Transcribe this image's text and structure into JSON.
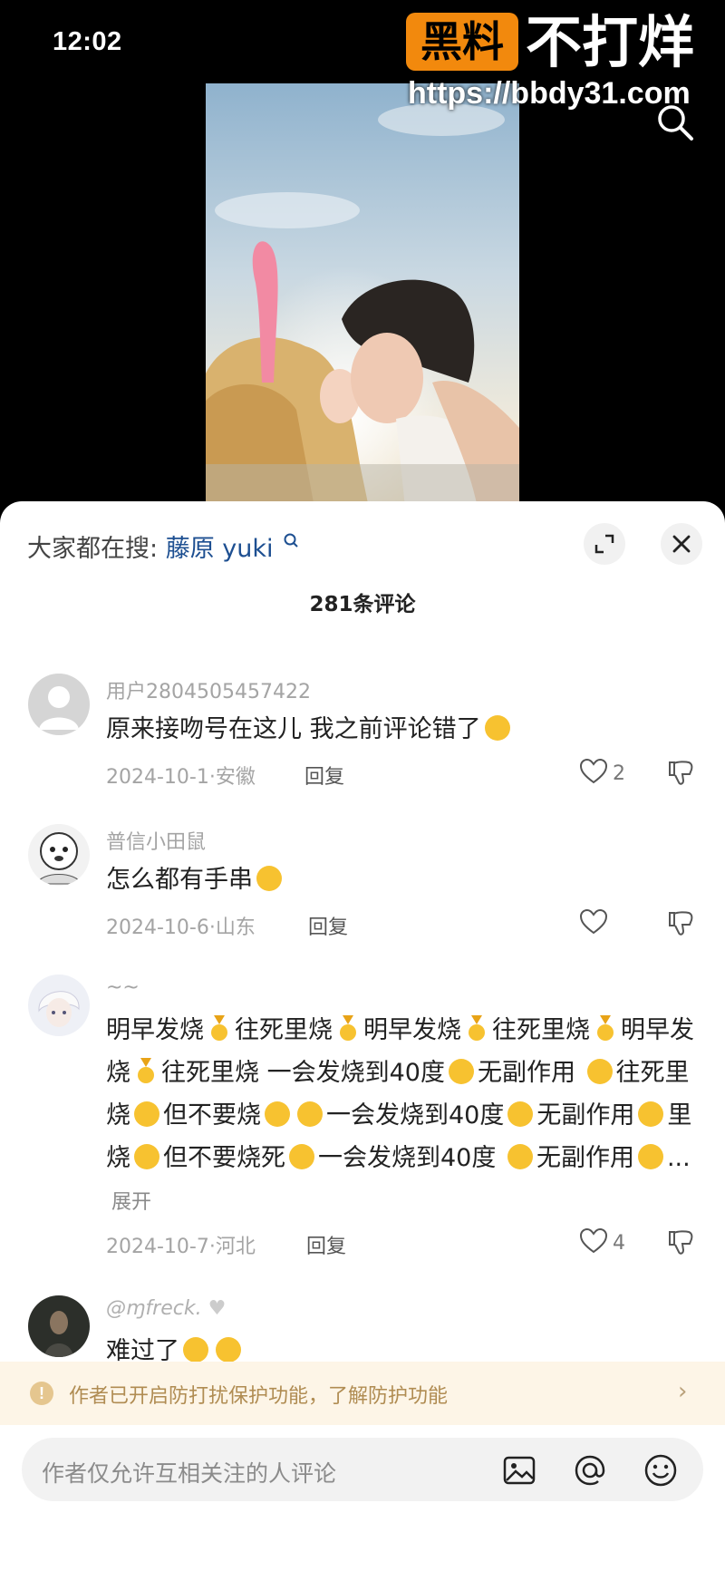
{
  "status_bar": {
    "time": "12:02"
  },
  "watermark": {
    "badge": "黑料",
    "text": "不打烊",
    "url": "https://bbdy31.com"
  },
  "sheet": {
    "hot_search_prefix": "大家都在搜:",
    "hot_search_keyword": "藤原 yuki",
    "comment_count": "281条评论"
  },
  "comments": [
    {
      "username": "用户2804505457422",
      "text": "原来接吻号在这儿 我之前评论错了",
      "date_location": "2024-10-1·安徽",
      "reply_label": "回复",
      "likes": "2"
    },
    {
      "username": "普信小田鼠",
      "text": "怎么都有手串",
      "date_location": "2024-10-6·山东",
      "reply_label": "回复",
      "likes": ""
    },
    {
      "username": "~~",
      "text_parts": [
        "明早发烧",
        "往死里烧",
        "明早发烧",
        "往死里烧",
        "明早发烧",
        "往死里烧  一会发烧到40度",
        "无副作用",
        "往死里烧",
        "但不要烧",
        "一会发烧到40度",
        "无副作用",
        "里烧",
        "但不要烧死",
        "一会发烧到40度",
        "无副作用",
        "..."
      ],
      "expand_label": "展开",
      "date_location": "2024-10-7·河北",
      "reply_label": "回复",
      "likes": "4"
    },
    {
      "username": "@ɱfreck.",
      "text": "难过了"
    }
  ],
  "notice": {
    "text": "作者已开启防打扰保护功能，了解防护功能"
  },
  "input": {
    "placeholder": "作者仅允许互相关注的人评论"
  },
  "colors": {
    "accent_link": "#1d4f91",
    "watermark_badge": "#f2890d",
    "notice_bg": "#fdf5e7"
  }
}
